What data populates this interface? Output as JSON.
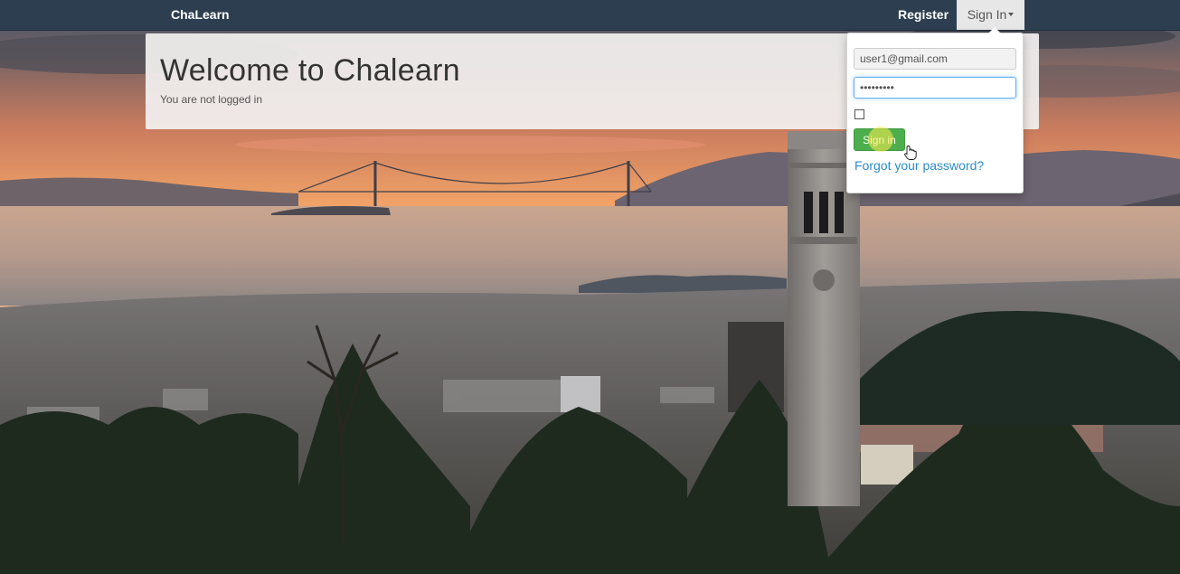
{
  "navbar": {
    "brand": "ChaLearn",
    "register_label": "Register",
    "signin_label": "Sign In"
  },
  "welcome": {
    "title": "Welcome to Chalearn",
    "status": "You are not logged in"
  },
  "signin_form": {
    "email_value": "user1@gmail.com",
    "password_value": "•••••••••",
    "remember_checked": false,
    "submit_label": "Sign in",
    "forgot_link": "Forgot your password?"
  },
  "colors": {
    "navbar_bg": "#2c3e50",
    "submit_button": "#4cae4c",
    "link": "#2a8ccc"
  }
}
